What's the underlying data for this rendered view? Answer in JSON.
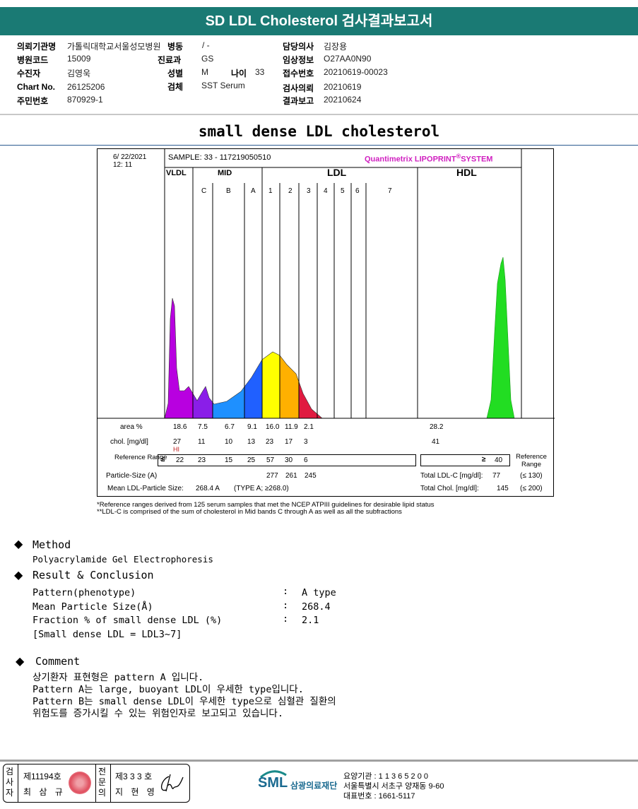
{
  "header": {
    "title": "SD LDL Cholesterol 검사결과보고서"
  },
  "info": {
    "institution_label": "의뢰기관명",
    "institution": "가톨릭대학교서울성모병원",
    "ward_label": "병동",
    "ward": "/ -",
    "doctor_label": "담당의사",
    "doctor": "김장용",
    "hospital_code_label": "병원코드",
    "hospital_code": "15009",
    "dept_label": "진료과",
    "dept": "GS",
    "clinical_label": "임상정보",
    "clinical": "O27AA0N90",
    "patient_label": "수진자",
    "patient": "김영욱",
    "sex_label": "성별",
    "sex": "M",
    "age_label": "나이",
    "age": "33",
    "receipt_label": "접수번호",
    "receipt": "20210619-00023",
    "chart_label": "Chart No.",
    "chart_no": "26125206",
    "specimen_label": "검체",
    "specimen": "SST Serum",
    "request_label": "검사의뢰",
    "request": "20210619",
    "id_label": "주민번호",
    "id": "870929-1",
    "report_label": "결과보고",
    "report": "20210624"
  },
  "subtitle": "small dense LDL cholesterol",
  "lipoprint": {
    "date": "6/ 22/2021",
    "time": "12: 11",
    "sample": "SAMPLE:   33 - 117219050510",
    "brand": "Quantimetrix LIPOPRINT",
    "reg": "®",
    "brand2": "SYSTEM",
    "groups": [
      "VLDL",
      "MID",
      "LDL",
      "HDL"
    ],
    "bands": [
      "C",
      "B",
      "A",
      "1",
      "2",
      "3",
      "4",
      "5",
      "6",
      "7"
    ],
    "band_colors": {
      "VLDL": "#b800e0",
      "C": "#8a1ee8",
      "B": "#1e90ff",
      "A": "#2060ff",
      "LDL1": "#ffff00",
      "LDL2": "#ffb000",
      "LDL3": "#e01a40",
      "HDL": "#22dd22"
    },
    "area_label": "area %",
    "area": [
      "18.6",
      "7.5",
      "6.7",
      "9.1",
      "16.0",
      "11.9",
      "2.1"
    ],
    "hdl_area": "28.2",
    "chol_label": "chol. [mg/dl]",
    "chol": [
      "27",
      "11",
      "10",
      "13",
      "23",
      "17",
      "3"
    ],
    "hdl_chol": "41",
    "hi_flag": "HI",
    "ref_label": "Reference Range",
    "ref_le": "≤",
    "ref": [
      "22",
      "23",
      "15",
      "25",
      "57",
      "30",
      "6"
    ],
    "hdl_ref_ge": "≥",
    "hdl_ref": "40",
    "ref_label_right": "Reference Range",
    "particle_label": "Particle-Size (A)",
    "particle": [
      "277",
      "261",
      "245"
    ],
    "mean_label": "Mean LDL-Particle Size:",
    "mean_value": "268.4  A",
    "mean_type": "(TYPE A; ≥268.0)",
    "total_ldl_label": "Total LDL-C [mg/dl]:",
    "total_ldl": "77",
    "total_ldl_ref": "(≤ 130)",
    "total_chol_label": "Total Chol. [mg/dl]:",
    "total_chol": "145",
    "total_chol_ref": "(≤ 200)",
    "footnote1": "*Reference ranges derived from 125 serum samples that met the NCEP ATPIII guidelines for desirable lipid status",
    "footnote2": "**LDL-C is comprised of the sum of cholesterol in Mid bands C through A as well as all the subfractions"
  },
  "method": {
    "heading": "Method",
    "text": "Polyacrylamide Gel Electrophoresis"
  },
  "result": {
    "heading": "Result & Conclusion",
    "rows": [
      {
        "k": "Pattern(phenotype)",
        "v": "A type"
      },
      {
        "k": "Mean Particle Size(Å)",
        "v": "268.4"
      },
      {
        "k": "Fraction % of small dense LDL (%)",
        "v": "2.1"
      }
    ],
    "sep": ":",
    "note": "[Small dense LDL = LDL3~7]"
  },
  "comment": {
    "heading": "Comment",
    "lines": [
      "상기환자 표현형은 pattern A 입니다.",
      "Pattern A는 large, buoyant LDL이 우세한 type입니다.",
      "Pattern B는 small dense LDL이 우세한 type으로 심혈관 질환의",
      "위험도를 증가시킬 수 있는 위험인자로 보고되고 있습니다."
    ]
  },
  "footer": {
    "examiner_label": "검사자",
    "examiner_no": "제11194호",
    "examiner": "최 삼 규",
    "specialist_label": "전문의",
    "specialist_no": "제3 3 3 호",
    "specialist": "지 현 영",
    "logo": "SML",
    "org": "삼광의료재단",
    "inst_code": "요양기관 : 1 1 3 6 5 2 0 0",
    "address": "서울특별시 서초구 양재동 9-60",
    "phone": "대표번호 : 1661-5117"
  }
}
